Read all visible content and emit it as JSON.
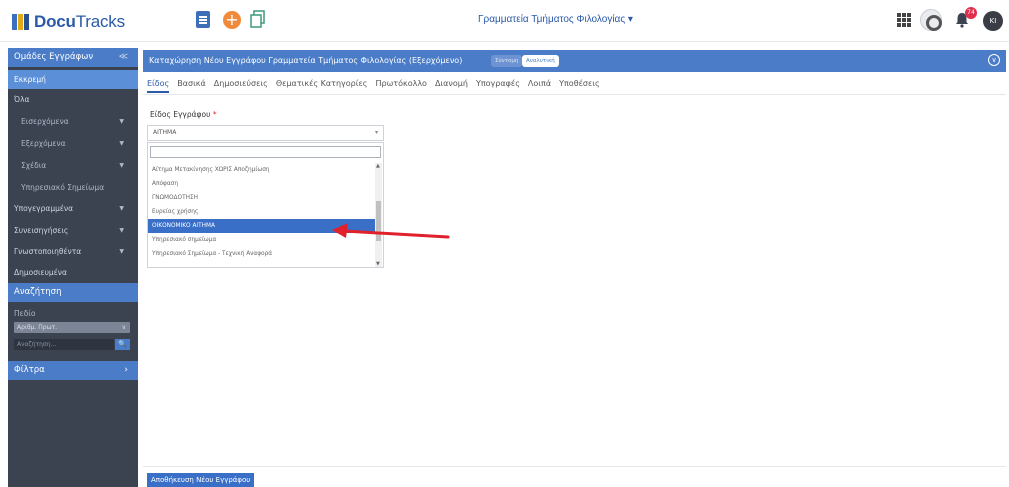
{
  "app": {
    "logo_text_bold": "Docu",
    "logo_text": "Tracks"
  },
  "topbar": {
    "org_title": "Γραμματεία Τμήματος Φιλολογίας ▾",
    "notification_count": "74",
    "avatar_initials": "KI"
  },
  "sidebar": {
    "groups_title": "Ομάδες Εγγράφων",
    "collapse_glyph": "≪",
    "items": [
      {
        "label": "Εκκρεμή"
      },
      {
        "label": "Όλα"
      },
      {
        "label": "Εισερχόμενα"
      },
      {
        "label": "Εξερχόμενα"
      },
      {
        "label": "Σχέδια"
      },
      {
        "label": "Υπηρεσιακό Σημείωμα"
      },
      {
        "label": "Υπογεγραμμένα"
      },
      {
        "label": "Συνεισηγήσεις"
      },
      {
        "label": "Γνωστοποιηθέντα"
      },
      {
        "label": "Δημοσιευμένα"
      }
    ],
    "search_title": "Αναζήτηση",
    "field_label": "Πεδίο",
    "field_value": "Αριθμ. Πρωτ.",
    "search_placeholder": "Αναζήτηση...",
    "filters_label": "Φίλτρα"
  },
  "header": {
    "title": "Καταχώρηση Νέου Εγγράφου Γραμματεία Τμήματος Φιλολογίας (Εξερχόμενο)",
    "simple_label": "Σύντομη",
    "detailed_label": "Αναλυτική"
  },
  "tabs": [
    {
      "label": "Είδος"
    },
    {
      "label": "Βασικά"
    },
    {
      "label": "Δημοσιεύσεις"
    },
    {
      "label": "Θεματικές Κατηγορίες"
    },
    {
      "label": "Πρωτόκολλο"
    },
    {
      "label": "Διανομή"
    },
    {
      "label": "Υπογραφές"
    },
    {
      "label": "Λοιπά"
    },
    {
      "label": "Υποθέσεις"
    }
  ],
  "form": {
    "doc_type_label": "Είδος Εγγράφου",
    "required_mark": "*",
    "doc_type_value": "ΑΙΤΗΜΑ",
    "options": [
      "Αίτημα Μετακίνησης ΧΩΡΙΣ Αποζημίωση",
      "Απόφαση",
      "ΓΝΩΜΟΔΟΤΗΣΗ",
      "Ευρείας χρήσης",
      "ΟΙΚΟΝΟΜΙΚΟ ΑΙΤΗΜΑ",
      "Υπηρεσιακό σημείωμα",
      "Υπηρεσιακό Σημείωμα - Τεχνική Αναφορά"
    ],
    "selected_option": "ΟΙΚΟΝΟΜΙΚΟ ΑΙΤΗΜΑ"
  },
  "footer": {
    "save_label": "Αποθήκευση Νέου Εγγράφου"
  },
  "colors": {
    "accent": "#4a7cc8",
    "sidebar_bg": "#3b4250",
    "arrow": "#e0202a"
  }
}
